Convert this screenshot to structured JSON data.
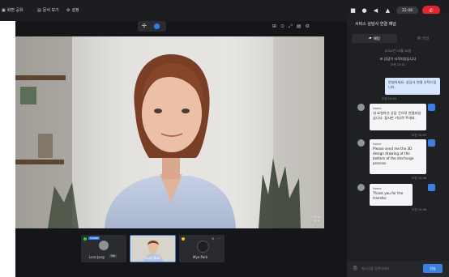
{
  "topbar": {
    "tabs": [
      {
        "icon": "screen-share-icon",
        "label": "화면 공유"
      },
      {
        "icon": "document-icon",
        "label": "문서 보기"
      },
      {
        "icon": "settings-icon",
        "label": "설정"
      }
    ],
    "status_icons": [
      "camera-icon",
      "mic-icon",
      "speaker-icon",
      "bell-icon"
    ],
    "timer": "22:48",
    "end_call_icon": "phone-end-icon"
  },
  "video_tools": {
    "icons": [
      "pin-icon",
      "record-icon"
    ]
  },
  "stage_tools": {
    "icons": [
      "grid-icon",
      "layout-icon",
      "expand-icon",
      "file-icon",
      "gear-icon"
    ]
  },
  "video": {
    "fullscreen_icon": "fullscreen-icon"
  },
  "participants": [
    {
      "name": "Lora Jang",
      "badge": "Guide",
      "tag": "Me",
      "status": "green"
    },
    {
      "name": "Lucy Bae",
      "badge": "",
      "tag": "",
      "status": ""
    },
    {
      "name": "Mye Park",
      "badge": "",
      "tag": "",
      "status": "yellow"
    }
  ],
  "chat": {
    "title": "서비스 상담사 연결 채널",
    "tabs": [
      {
        "icon": "chat-icon",
        "label": "채팅"
      },
      {
        "icon": "file-icon",
        "label": "파일"
      }
    ],
    "date_label": "2024년 03월 18일",
    "system_msg": "상담이 시작되었습니다",
    "system_time": "오전 10:01",
    "messages": [
      {
        "from": "me",
        "text": "안녕하세요. 상담사 연결 부탁드립니다.",
        "time": "오전 10:03"
      },
      {
        "from": "other",
        "name": "Name",
        "text": "네 요청하신 상담 건으로 연결되었습니다. 잠시만 기다려 주세요.",
        "time": "오전 10:04"
      },
      {
        "from": "other",
        "name": "Name",
        "text": "Please send me the 3D design drawing at the bottom of the discharge process.",
        "time": "오전 10:06"
      },
      {
        "from": "other",
        "name": "Name",
        "text": "Thank you for the transfer.",
        "time": "오전 10:08"
      }
    ],
    "input_placeholder": "메시지를 입력하세요",
    "send_label": "전송"
  }
}
